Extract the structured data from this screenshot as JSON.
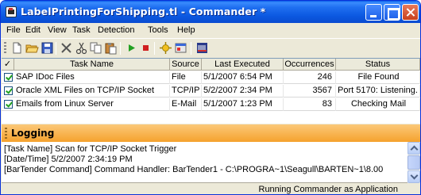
{
  "window": {
    "title": "LabelPrintingForShipping.tl - Commander *"
  },
  "menu": [
    "File",
    "Edit",
    "View",
    "Task",
    "Detection",
    "Tools",
    "Help"
  ],
  "toolbar": {
    "icons": [
      "new-icon",
      "open-icon",
      "save-icon",
      "delete-icon",
      "cut-icon",
      "copy-icon",
      "paste-icon",
      "start-icon",
      "stop-icon",
      "options-icon",
      "properties-icon",
      "bartender-icon"
    ]
  },
  "table": {
    "check_header": "✓",
    "headers": [
      "Task Name",
      "Source",
      "Last Executed",
      "Occurrences",
      "Status"
    ],
    "rows": [
      {
        "task": "SAP IDoc Files",
        "source": "File",
        "last": "5/1/2007 6:54 PM",
        "occ": "246",
        "status": "File Found"
      },
      {
        "task": "Oracle XML Files on TCP/IP Socket",
        "source": "TCP/IP",
        "last": "5/2/2007 2:34 PM",
        "occ": "3567",
        "status": "Port 5170: Listening."
      },
      {
        "task": "Emails from Linux Server",
        "source": "E-Mail",
        "last": "5/1/2007 1:23 PM",
        "occ": "83",
        "status": "Checking Mail"
      }
    ]
  },
  "logging": {
    "title": "Logging",
    "lines": [
      "[Task Name] Scan for TCP/IP Socket Trigger",
      "[Date/Time] 5/2/2007 2:34:19 PM",
      "[BarTender Command] Command Handler: BarTender1 - C:\\PROGRA~1\\Seagull\\BARTEN~1\\8.00"
    ]
  },
  "status": {
    "text": "Running Commander as Application"
  },
  "colors": {
    "title_bar": "#0a5ee8",
    "logging_header": "#f5a22d",
    "checkmark": "#21a121"
  }
}
